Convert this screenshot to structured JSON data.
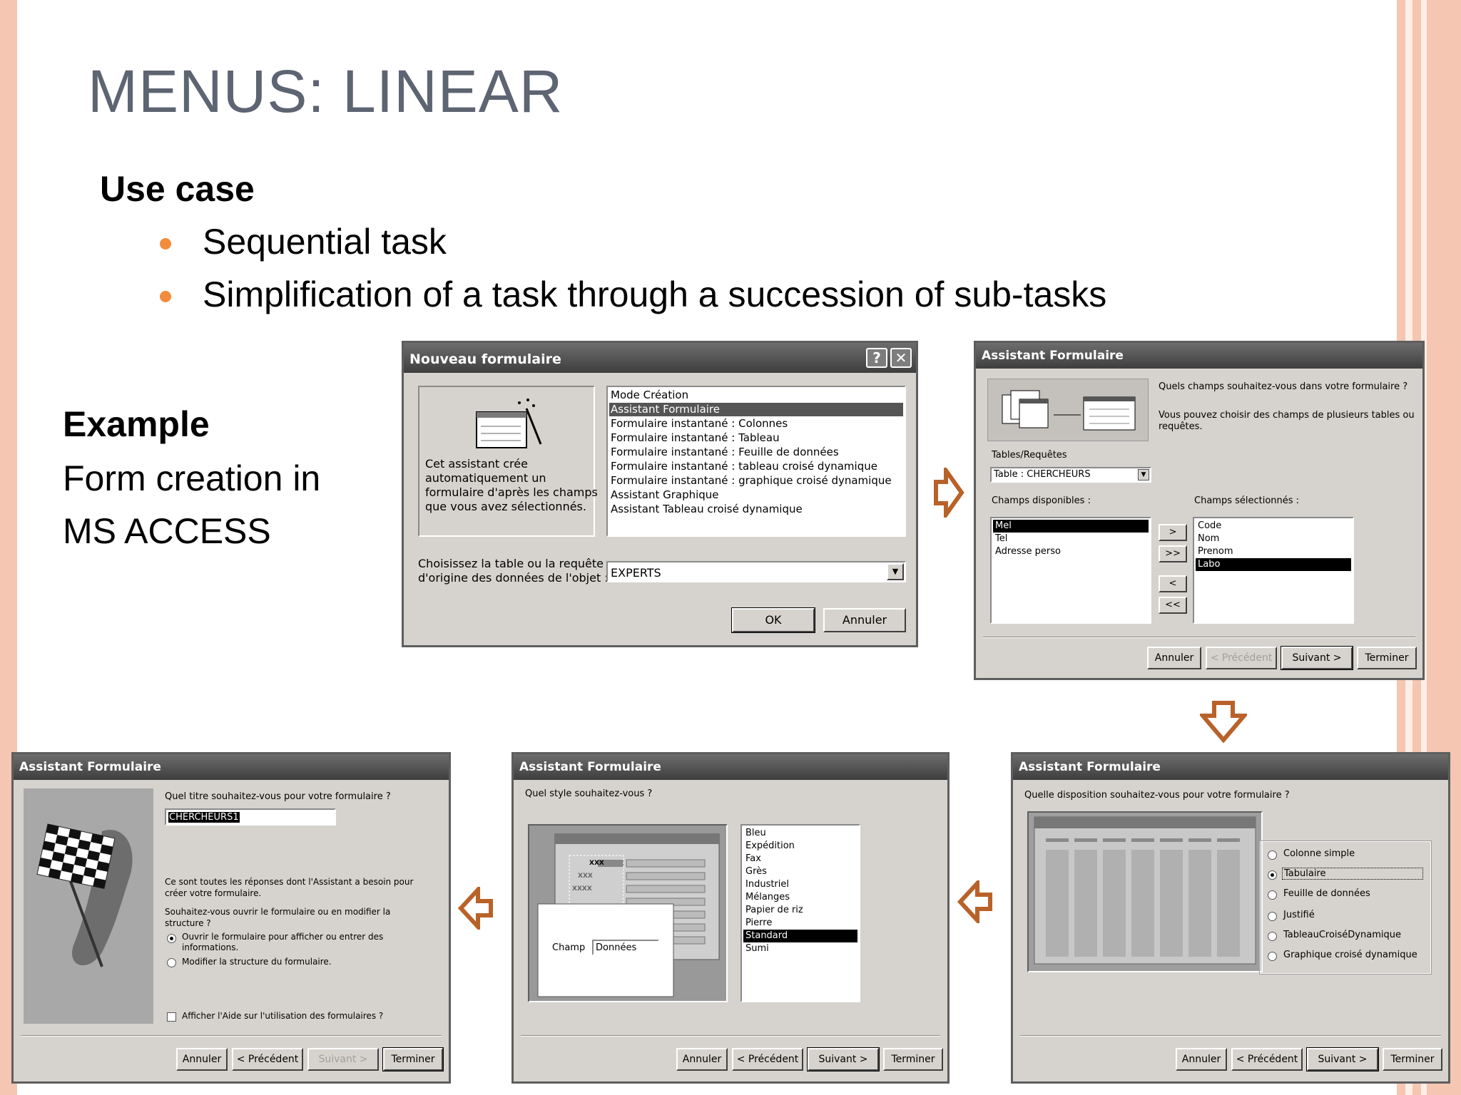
{
  "slide": {
    "title": "MENUS: LINEAR",
    "use_case_heading": "Use case",
    "bullets": [
      "Sequential task",
      "Simplification of a task through a succession of sub-tasks"
    ],
    "example_heading": "Example",
    "example_lines": [
      "Form creation in",
      "MS ACCESS"
    ],
    "accent": "#f28c3c",
    "arrow_color": "#b8622a"
  },
  "dialog1": {
    "title": "Nouveau formulaire",
    "help_glyph": "?",
    "close_glyph": "✕",
    "description": [
      "Cet assistant crée",
      "automatiquement un",
      "formulaire d'après les champs",
      "que vous avez sélectionnés."
    ],
    "list": [
      "Mode Création",
      "Assistant Formulaire",
      "Formulaire instantané : Colonnes",
      "Formulaire instantané : Tableau",
      "Formulaire instantané : Feuille de données",
      "Formulaire instantané : tableau croisé dynamique",
      "Formulaire instantané : graphique croisé dynamique",
      "Assistant Graphique",
      "Assistant Tableau croisé dynamique"
    ],
    "selected_index": 1,
    "source_label": [
      "Choisissez la table ou la requête",
      "d'origine des données de l'objet :"
    ],
    "source_value": "EXPERTS",
    "ok": "OK",
    "cancel": "Annuler"
  },
  "dialog2": {
    "title": "Assistant Formulaire",
    "question": "Quels champs souhaitez-vous dans votre formulaire ?",
    "hint": [
      "Vous pouvez choisir des champs de plusieurs tables ou",
      "requêtes."
    ],
    "tables_label": "Tables/Requêtes",
    "table_value": "Table : CHERCHEURS",
    "available_label": "Champs disponibles :",
    "available": [
      "Mel",
      "Tel",
      "Adresse perso"
    ],
    "selected_label": "Champs sélectionnés :",
    "selected": [
      "Code",
      "Nom",
      "Prenom",
      "Labo"
    ],
    "move_buttons": [
      ">",
      ">>",
      "<",
      "<<"
    ],
    "buttons": [
      "Annuler",
      "< Précédent",
      "Suivant >",
      "Terminer"
    ]
  },
  "dialog3": {
    "title": "Assistant Formulaire",
    "question": "Quelle disposition souhaitez-vous pour votre formulaire ?",
    "options": [
      "Colonne simple",
      "Tabulaire",
      "Feuille de données",
      "Justifié",
      "TableauCroiséDynamique",
      "Graphique croisé dynamique"
    ],
    "selected_index": 1,
    "buttons": [
      "Annuler",
      "< Précédent",
      "Suivant >",
      "Terminer"
    ]
  },
  "dialog4": {
    "title": "Assistant Formulaire",
    "question": "Quel style souhaitez-vous ?",
    "preview_marks": [
      "XXX",
      "XXX",
      "XXXX"
    ],
    "preview_field_label": "Champ",
    "preview_field_value": "Données",
    "styles": [
      "Bleu",
      "Expédition",
      "Fax",
      "Grès",
      "Industriel",
      "Mélanges",
      "Papier de riz",
      "Pierre",
      "Standard",
      "Sumi"
    ],
    "selected_index": 8,
    "buttons": [
      "Annuler",
      "< Précédent",
      "Suivant >",
      "Terminer"
    ]
  },
  "dialog5": {
    "title": "Assistant Formulaire",
    "question": "Quel titre souhaitez-vous pour votre formulaire ?",
    "form_title_value": "CHERCHEURS1",
    "info": [
      "Ce sont toutes les réponses dont l'Assistant a besoin pour",
      "créer votre formulaire."
    ],
    "open_question": [
      "Souhaitez-vous ouvrir le formulaire ou en modifier la",
      "structure ?"
    ],
    "option_open": [
      "Ouvrir le formulaire pour afficher ou entrer des",
      "informations."
    ],
    "option_modify": "Modifier la structure du formulaire.",
    "help_checkbox": "Afficher l'Aide sur l'utilisation des formulaires ?",
    "buttons": [
      "Annuler",
      "< Précédent",
      "Suivant >",
      "Terminer"
    ]
  }
}
